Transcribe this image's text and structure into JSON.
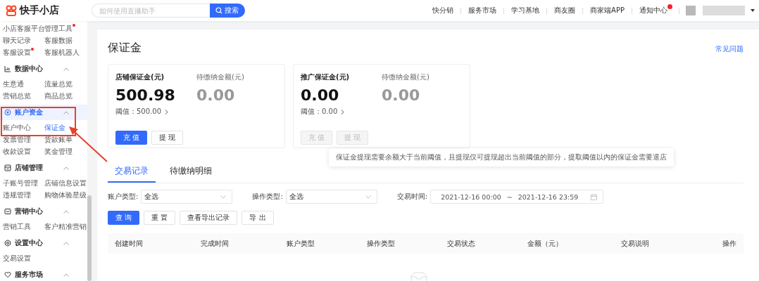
{
  "header": {
    "logo": "快手小店",
    "search": {
      "placeholder": "如何使用直播助手",
      "button": "搜索"
    },
    "links": [
      {
        "label": "快分销",
        "badge": false
      },
      {
        "label": "服务市场",
        "badge": false
      },
      {
        "label": "学习基地",
        "badge": false
      },
      {
        "label": "商友圈",
        "badge": false
      },
      {
        "label": "商家端APP",
        "badge": false
      },
      {
        "label": "通知中心",
        "badge": true
      }
    ]
  },
  "sidebar": {
    "groups": [
      {
        "items": [
          {
            "label": "小店客服平台",
            "dot": false,
            "selected": false
          },
          {
            "label": "管理工具",
            "dot": true,
            "selected": false
          },
          {
            "label": "聊天记录",
            "dot": false,
            "selected": false
          },
          {
            "label": "客服数据",
            "dot": false,
            "selected": false
          },
          {
            "label": "客服设置",
            "dot": true,
            "selected": false
          },
          {
            "label": "客服机器人",
            "dot": false,
            "selected": false
          }
        ]
      },
      {
        "title": "数据中心",
        "expanded": true,
        "items": [
          {
            "label": "生意通",
            "dot": false,
            "selected": false
          },
          {
            "label": "流量总览",
            "dot": false,
            "selected": false
          },
          {
            "label": "营销总览",
            "dot": false,
            "selected": false
          },
          {
            "label": "商品总览",
            "dot": false,
            "selected": false
          }
        ]
      },
      {
        "title": "账户资金",
        "expanded": true,
        "annotated": true,
        "items": [
          {
            "label": "账户中心",
            "dot": false,
            "selected": false
          },
          {
            "label": "保证金",
            "dot": false,
            "selected": true
          },
          {
            "label": "发票管理",
            "dot": false,
            "selected": false
          },
          {
            "label": "货款账单",
            "dot": false,
            "selected": false
          },
          {
            "label": "收款设置",
            "dot": false,
            "selected": false
          },
          {
            "label": "奖金管理",
            "dot": false,
            "selected": false
          }
        ]
      },
      {
        "title": "店铺管理",
        "expanded": true,
        "items": [
          {
            "label": "子账号管理",
            "dot": false,
            "selected": false
          },
          {
            "label": "店铺信息设置",
            "dot": false,
            "selected": false
          },
          {
            "label": "违规管理",
            "dot": false,
            "selected": false
          },
          {
            "label": "购物体验星级",
            "dot": false,
            "selected": false
          }
        ]
      },
      {
        "title": "营销中心",
        "expanded": true,
        "items": [
          {
            "label": "营销工具",
            "dot": false,
            "selected": false
          },
          {
            "label": "客户精准营销",
            "dot": false,
            "selected": false
          }
        ]
      },
      {
        "title": "设置中心",
        "expanded": true,
        "items": [
          {
            "label": "交易设置",
            "dot": false,
            "selected": false
          }
        ]
      },
      {
        "title": "服务市场",
        "expanded": true
      }
    ]
  },
  "page": {
    "title": "保证金",
    "help_link": "常见问题",
    "cards": [
      {
        "label": "店铺保证金(元)",
        "amount": "500.98",
        "pending_label": "待缴纳金额(元)",
        "pending_amount": "0.00",
        "threshold": "阈值：500.00",
        "buttons": [
          {
            "label": "充 值",
            "kind": "primary",
            "disabled": false
          },
          {
            "label": "提 现",
            "kind": "default",
            "disabled": false
          }
        ]
      },
      {
        "label": "推广保证金(元)",
        "amount": "0.00",
        "pending_label": "待缴纳金额(元)",
        "pending_amount": "0.00",
        "threshold": "阈值：0.00",
        "buttons": [
          {
            "label": "充 值",
            "kind": "primary",
            "disabled": true
          },
          {
            "label": "提 现",
            "kind": "default",
            "disabled": true
          }
        ],
        "tooltip": "保证金提现需要余额大于当前阈值，且提现仅可提现超出当前阈值的部分，提取阈值以内的保证金需要退店"
      }
    ],
    "tabs": [
      {
        "label": "交易记录",
        "selected": true
      },
      {
        "label": "待缴纳明细",
        "selected": false
      }
    ],
    "filters": [
      {
        "kind": "select",
        "label": "账户类型:",
        "value": "全选"
      },
      {
        "kind": "select",
        "label": "操作类型:",
        "value": "全选"
      },
      {
        "kind": "daterange",
        "label": "交易时间:",
        "start": "2021-12-16 00:00",
        "separator": "~",
        "end": "2021-12-16 23:59"
      }
    ],
    "actions": [
      {
        "label": "查 询",
        "kind": "primary"
      },
      {
        "label": "重 置",
        "kind": "default"
      },
      {
        "label": "查看导出记录",
        "kind": "default"
      },
      {
        "label": "导 出",
        "kind": "default"
      }
    ],
    "table": {
      "columns": [
        "创建时间",
        "完成时间",
        "账户类型",
        "操作类型",
        "交易状态",
        "金额（元）",
        "交易说明",
        "操作"
      ]
    }
  }
}
